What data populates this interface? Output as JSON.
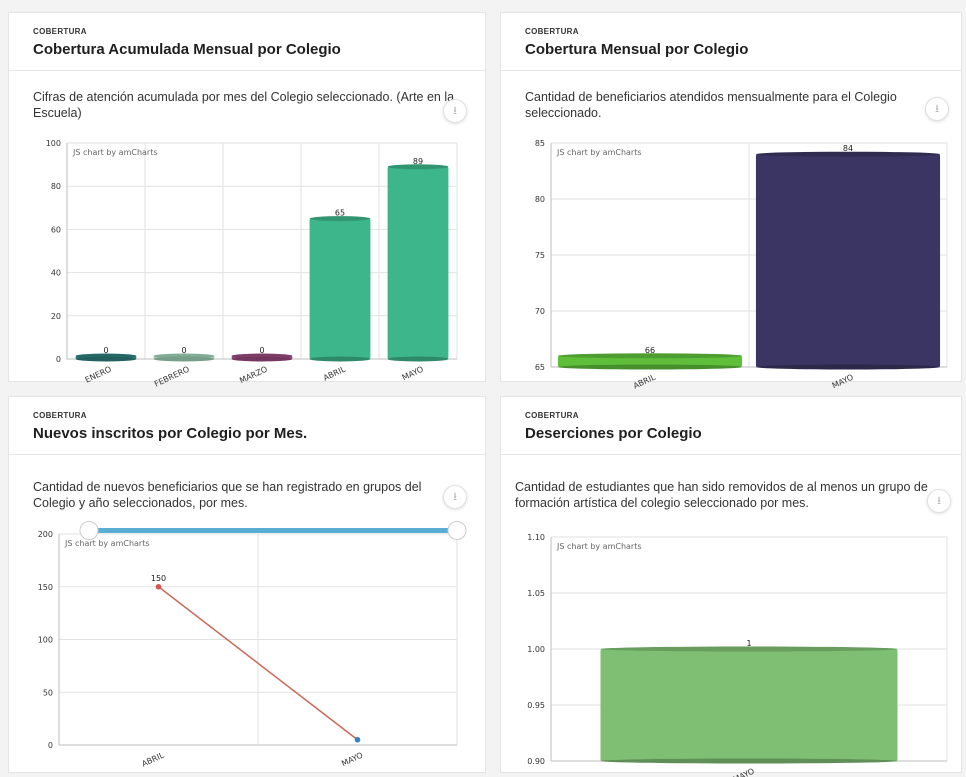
{
  "cards": [
    {
      "kicker": "COBERTURA",
      "title": "Cobertura Acumulada Mensual por Colegio",
      "description": "Cifras de atención acumulada por mes del Colegio seleccionado. (Arte en la Escuela)",
      "credit": "JS chart by amCharts"
    },
    {
      "kicker": "COBERTURA",
      "title": "Cobertura Mensual por Colegio",
      "description": "Cantidad de beneficiarios atendidos mensualmente para el Colegio seleccionado.",
      "credit": "JS chart by amCharts"
    },
    {
      "kicker": "COBERTURA",
      "title": "Nuevos inscritos por Colegio por Mes.",
      "description": "Cantidad de nuevos beneficiarios que se han registrado en grupos del Colegio y año seleccionados, por mes.",
      "credit": "JS chart by amCharts"
    },
    {
      "kicker": "COBERTURA",
      "title": "Deserciones por Colegio",
      "description": "Cantidad de estudiantes que han sido removidos de al menos un grupo de formación artística del colegio seleccionado por mes.",
      "credit": "JS chart by amCharts"
    }
  ],
  "download_icon": "download-icon",
  "chart_data": [
    {
      "type": "bar",
      "categories": [
        "ENERO",
        "FEBRERO",
        "MARZO",
        "ABRIL",
        "MAYO"
      ],
      "values": [
        0,
        0,
        0,
        65,
        89
      ],
      "colors": [
        "#2e7f7f",
        "#9dd3b8",
        "#9b4a80",
        "#3cb68a",
        "#3cb68a"
      ],
      "yticks": [
        "0",
        "20",
        "40",
        "60",
        "80",
        "100"
      ],
      "ylim": [
        0,
        100
      ],
      "title": "",
      "xlabel": "",
      "ylabel": ""
    },
    {
      "type": "bar",
      "categories": [
        "ABRIL",
        "MAYO"
      ],
      "values": [
        66,
        84
      ],
      "colors": [
        "#5fbf3a",
        "#3b3563"
      ],
      "yticks": [
        "65",
        "70",
        "75",
        "80",
        "85"
      ],
      "ylim": [
        65,
        85
      ],
      "title": "",
      "xlabel": "",
      "ylabel": ""
    },
    {
      "type": "line",
      "categories": [
        "ABRIL",
        "MAYO"
      ],
      "values": [
        150,
        5
      ],
      "point_labels": [
        "150",
        ""
      ],
      "point_colors": [
        "#d9534f",
        "#3b7fc4"
      ],
      "line_color": "#c86a5a",
      "yticks": [
        "0",
        "50",
        "100",
        "150",
        "200"
      ],
      "ylim": [
        0,
        200
      ],
      "scrollbar_color": "#5aaed6",
      "title": "",
      "xlabel": "",
      "ylabel": ""
    },
    {
      "type": "bar",
      "categories": [
        "MAYO"
      ],
      "values": [
        1
      ],
      "colors": [
        "#7fbf73"
      ],
      "yticks": [
        "0.90",
        "0.95",
        "1.00",
        "1.05",
        "1.10"
      ],
      "ylim": [
        0.9,
        1.1
      ],
      "title": "",
      "xlabel": "",
      "ylabel": ""
    }
  ]
}
